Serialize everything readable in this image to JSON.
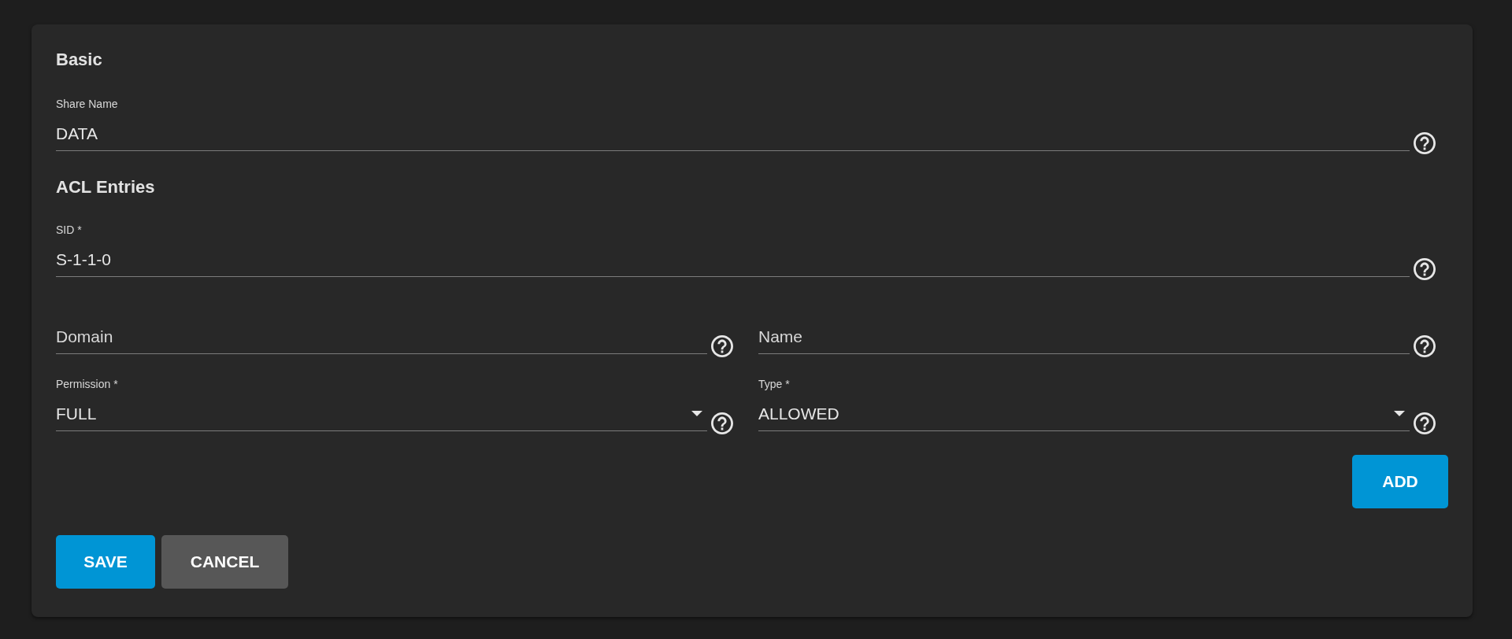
{
  "basic": {
    "heading": "Basic",
    "fields": [
      {
        "kind": "input",
        "label": "Share Name",
        "value": "DATA"
      }
    ]
  },
  "acl": {
    "heading": "ACL Entries",
    "rows": [
      [
        {
          "kind": "input",
          "label": "SID *",
          "value": "S-1-1-0"
        }
      ],
      [
        {
          "kind": "input",
          "placeholder": "Domain"
        },
        {
          "kind": "input",
          "placeholder": "Name"
        }
      ],
      [
        {
          "kind": "select",
          "label": "Permission *",
          "value": "FULL"
        },
        {
          "kind": "select",
          "label": "Type *",
          "value": "ALLOWED"
        }
      ]
    ],
    "add_button": "ADD"
  },
  "buttons": [
    {
      "kind": "primary",
      "label": "SAVE"
    },
    {
      "kind": "secondary",
      "label": "CANCEL"
    }
  ]
}
